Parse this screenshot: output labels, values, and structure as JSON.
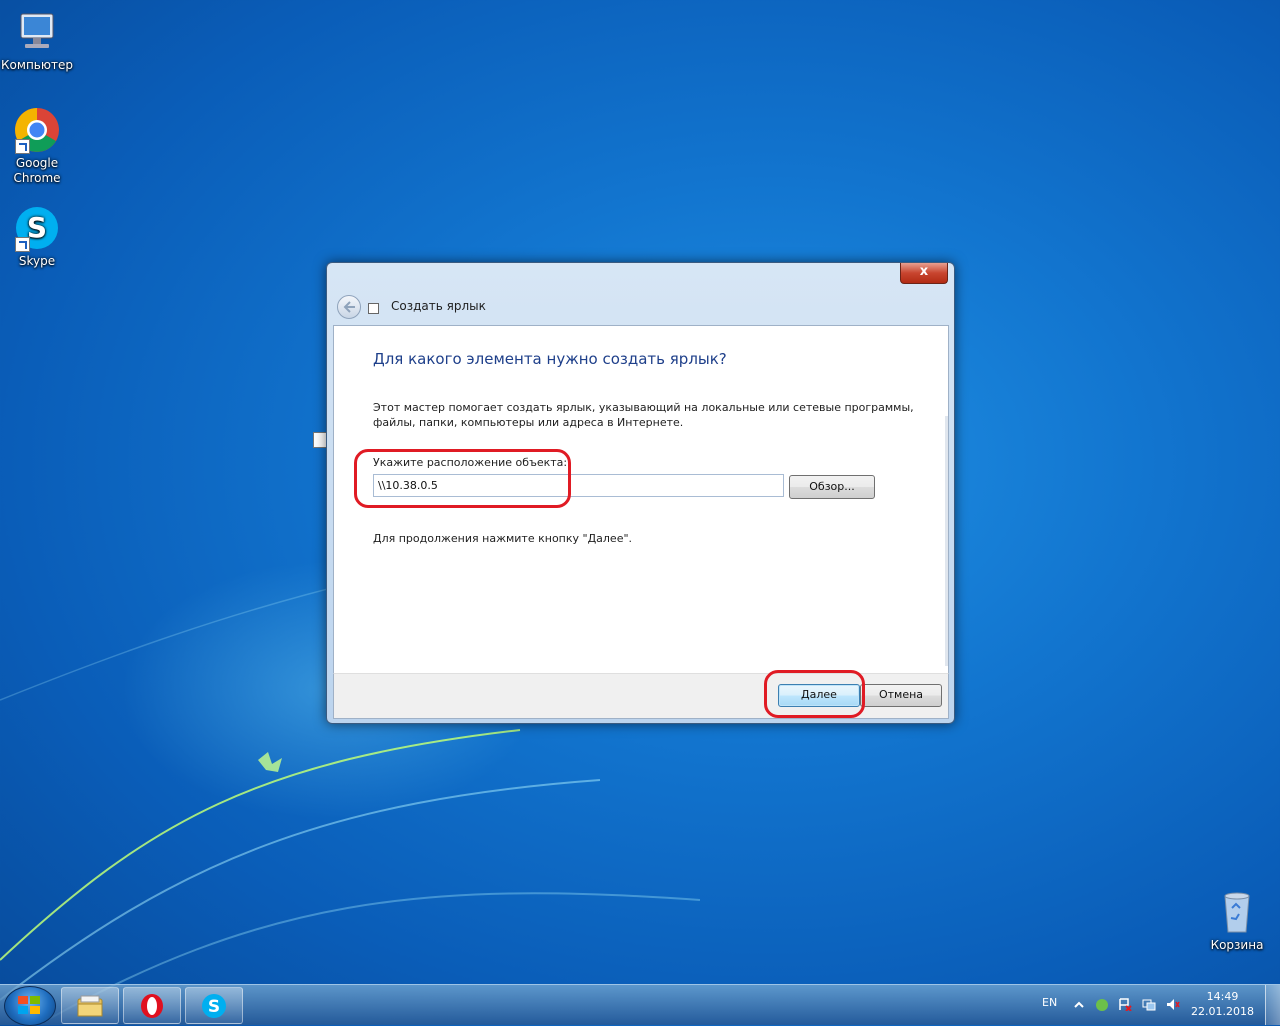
{
  "desktop": {
    "icons": [
      {
        "label": "Компьютер"
      },
      {
        "label": "Google Chrome"
      },
      {
        "label": "Skype"
      },
      {
        "label": "Корзина"
      }
    ]
  },
  "dialog": {
    "close_label": "x",
    "title": "Создать ярлык",
    "heading": "Для какого элемента нужно создать ярлык?",
    "description": "Этот мастер помогает создать ярлык, указывающий на локальные или сетевые программы, файлы, папки, компьютеры или адреса в Интернете.",
    "location_label": "Укажите расположение объекта:",
    "location_value": "\\\\10.38.0.5",
    "browse_label": "Обзор...",
    "hint": "Для продолжения нажмите кнопку \"Далее\".",
    "next_label": "Далее",
    "cancel_label": "Отмена"
  },
  "taskbar": {
    "language": "EN",
    "time": "14:49",
    "date": "22.01.2018",
    "items": [
      {
        "icon": "explorer-icon"
      },
      {
        "icon": "opera-icon"
      },
      {
        "icon": "skype-icon"
      }
    ]
  },
  "colors": {
    "highlight": "#e01b24",
    "heading": "#1e3f8a"
  }
}
